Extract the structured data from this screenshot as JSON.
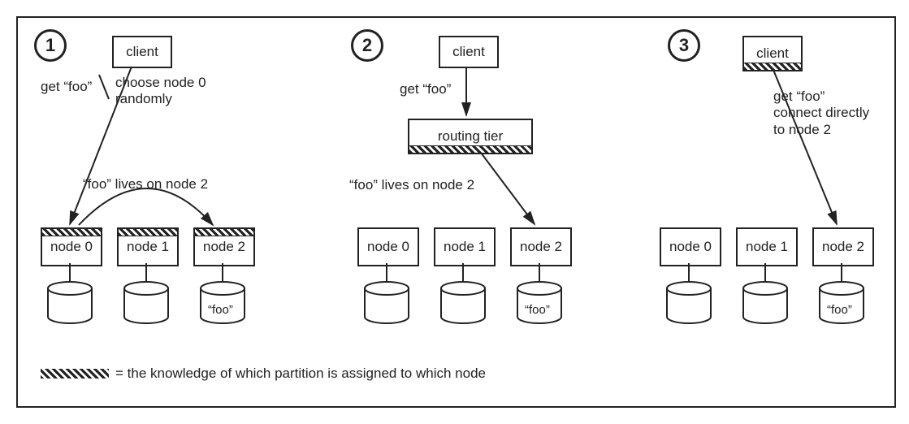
{
  "scenarios": [
    {
      "num": "1"
    },
    {
      "num": "2"
    },
    {
      "num": "3"
    }
  ],
  "boxes": {
    "client": "client",
    "routing_tier": "routing tier",
    "node0": "node 0",
    "node1": "node 1",
    "node2": "node 2"
  },
  "labels": {
    "s1_left": "get “foo”",
    "s1_right": "choose node 0\nrandomly",
    "s1_lives": "“foo” lives on node 2",
    "s2_get": "get “foo”",
    "s2_lives": "“foo” lives on node 2",
    "s3_text": "get “foo”\nconnect directly\nto node 2",
    "foo_in_cyl": "“foo”",
    "legend": "= the knowledge of which partition is assigned to which node"
  }
}
